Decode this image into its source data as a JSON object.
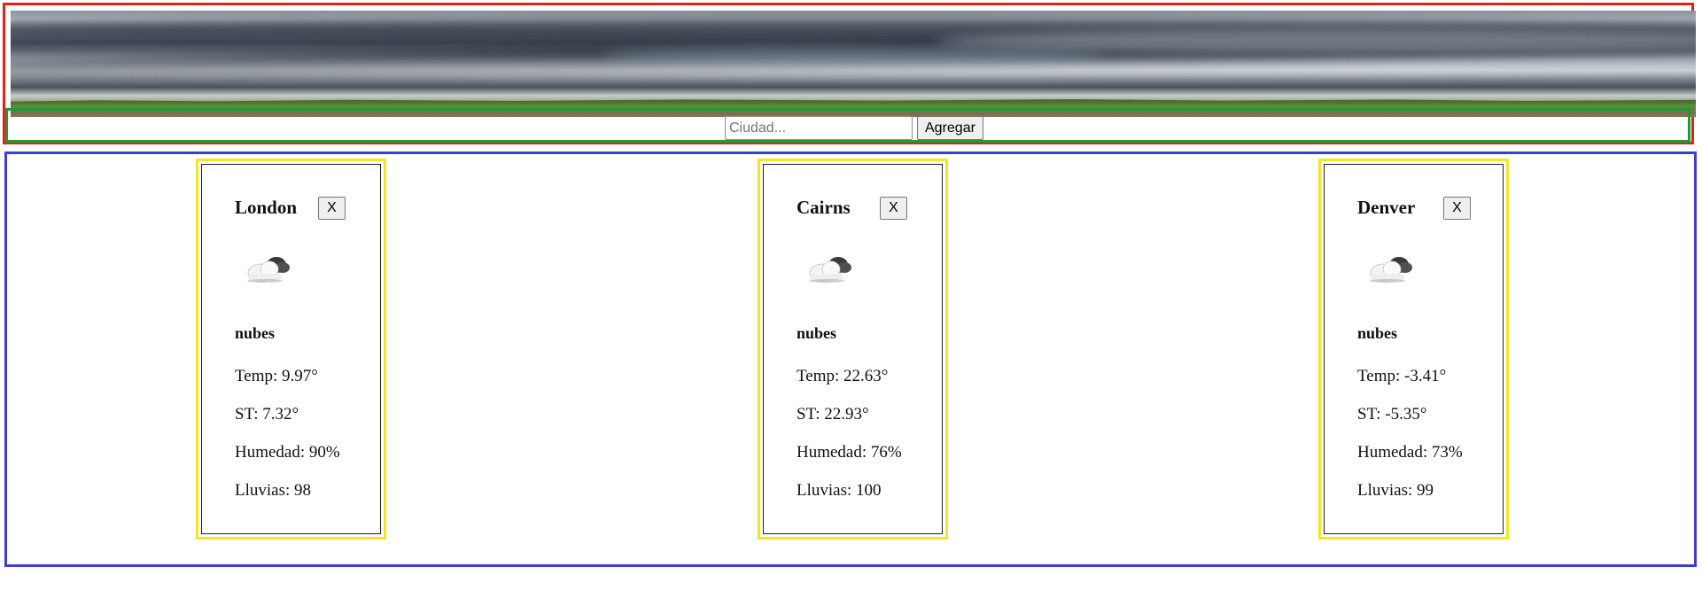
{
  "search": {
    "placeholder": "Ciudad...",
    "value": "",
    "add_label": "Agregar"
  },
  "cards": [
    {
      "city": "London",
      "remove_label": "X",
      "icon": "cloud-icon",
      "description": "nubes",
      "temp": "Temp: 9.97°",
      "feels_like": "ST: 7.32°",
      "humidity": "Humedad: 90%",
      "rain": "Lluvias: 98"
    },
    {
      "city": "Cairns",
      "remove_label": "X",
      "icon": "cloud-icon",
      "description": "nubes",
      "temp": "Temp: 22.63°",
      "feels_like": "ST: 22.93°",
      "humidity": "Humedad: 76%",
      "rain": "Lluvias: 100"
    },
    {
      "city": "Denver",
      "remove_label": "X",
      "icon": "cloud-icon",
      "description": "nubes",
      "temp": "Temp: -3.41°",
      "feels_like": "ST: -5.35°",
      "humidity": "Humedad: 73%",
      "rain": "Lluvias: 99"
    }
  ],
  "colors": {
    "header_border": "#e2231a",
    "search_border": "#1e9a36",
    "container_border": "#3a3fd0",
    "card_border": "#f5e623"
  }
}
